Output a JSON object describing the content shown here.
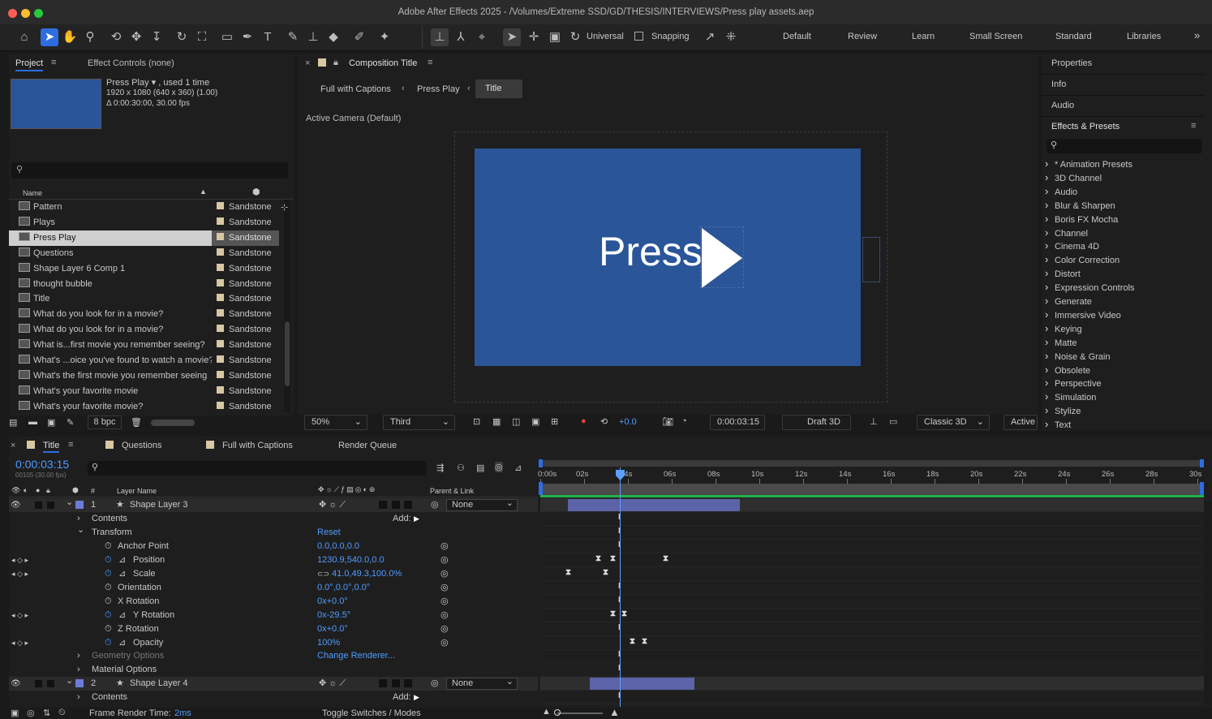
{
  "window": {
    "title": "Adobe After Effects 2025 - /Volumes/Extreme SSD/GD/THESIS/INTERVIEWS/Press play assets.aep"
  },
  "toolbar": {
    "universal": "Universal",
    "snapping": "Snapping",
    "workspaces": [
      "Default",
      "Review",
      "Learn",
      "Small Screen",
      "Standard",
      "Libraries"
    ],
    "more": "»"
  },
  "project": {
    "tab": "Project",
    "effect_controls": "Effect Controls (none)",
    "info_name": "Press Play ▾ , used 1 time",
    "info_size": "1920 x 1080  (640 x 360) (1.00)",
    "info_duration": "Δ 0:00:30:00, 30.00 fps",
    "col_name": "Name",
    "bpc": "8 bpc",
    "items": [
      {
        "name": "Pattern",
        "label": "Sandstone"
      },
      {
        "name": "Plays",
        "label": "Sandstone"
      },
      {
        "name": "Press Play",
        "label": "Sandstone"
      },
      {
        "name": "Questions",
        "label": "Sandstone"
      },
      {
        "name": "Shape Layer 6 Comp 1",
        "label": "Sandstone"
      },
      {
        "name": "thought bubble",
        "label": "Sandstone"
      },
      {
        "name": "Title",
        "label": "Sandstone"
      },
      {
        "name": "What do you look for in a movie?",
        "label": "Sandstone"
      },
      {
        "name": "What do you look for in a movie?",
        "label": "Sandstone"
      },
      {
        "name": "What is...first movie you remember seeing?",
        "label": "Sandstone"
      },
      {
        "name": "What's ...oice you've found to watch a movie?",
        "label": "Sandstone"
      },
      {
        "name": "What's the first movie you remember seeing",
        "label": "Sandstone"
      },
      {
        "name": "What's your favorite movie",
        "label": "Sandstone"
      },
      {
        "name": "What's your favorite movie?",
        "label": "Sandstone"
      }
    ]
  },
  "composition": {
    "tab": "Composition Title",
    "crumbs": [
      "Full with Captions",
      "Press Play",
      "Title"
    ],
    "camera": "Active Camera (Default)",
    "preview_text": "Press",
    "zoom": "50%",
    "resolution": "Third",
    "exposure": "+0.0",
    "timecode": "0:00:03:15",
    "draft": "Draft 3D",
    "renderer": "Classic 3D",
    "view": "Active"
  },
  "right": {
    "items": [
      "Properties",
      "Info",
      "Audio"
    ],
    "effects_title": "Effects & Presets",
    "effects": [
      "* Animation Presets",
      "3D Channel",
      "Audio",
      "Blur & Sharpen",
      "Boris FX Mocha",
      "Channel",
      "Cinema 4D",
      "Color Correction",
      "Distort",
      "Expression Controls",
      "Generate",
      "Immersive Video",
      "Keying",
      "Matte",
      "Noise & Grain",
      "Obsolete",
      "Perspective",
      "Simulation",
      "Stylize",
      "Text"
    ]
  },
  "timeline": {
    "tabs": [
      "Title",
      "Questions",
      "Full with Captions",
      "Render Queue"
    ],
    "time": "0:00:03:15",
    "frames": "00105 (30.00 fps)",
    "col_num": "#",
    "col_layer": "Layer Name",
    "col_parent": "Parent & Link",
    "ruler": [
      "0:00s",
      "02s",
      "04s",
      "06s",
      "08s",
      "10s",
      "12s",
      "14s",
      "16s",
      "18s",
      "20s",
      "22s",
      "24s",
      "26s",
      "28s",
      "30s"
    ],
    "rows": [
      {
        "label": "1",
        "name": "Shape Layer 3",
        "value": "",
        "parent": "None"
      },
      {
        "label": "Contents",
        "value": "Add:"
      },
      {
        "label": "Transform",
        "value": "Reset"
      },
      {
        "label": "Anchor Point",
        "value": "0.0,0.0,0.0"
      },
      {
        "label": "Position",
        "value": "1230.9,540.0,0.0"
      },
      {
        "label": "Scale",
        "value": "41.0,49.3,100.0%"
      },
      {
        "label": "Orientation",
        "value": "0.0°,0.0°,0.0°"
      },
      {
        "label": "X Rotation",
        "value": "0x+0.0°"
      },
      {
        "label": "Y Rotation",
        "value": "0x-29.5°"
      },
      {
        "label": "Z Rotation",
        "value": "0x+0.0°"
      },
      {
        "label": "Opacity",
        "value": "100%"
      },
      {
        "label": "Geometry Options",
        "value": "Change Renderer..."
      },
      {
        "label": "Material Options",
        "value": ""
      },
      {
        "label": "2",
        "name": "Shape Layer 4",
        "value": "",
        "parent": "None"
      },
      {
        "label": "Contents",
        "value": "Add:"
      }
    ],
    "frame_render_label": "Frame Render Time:",
    "frame_render_value": "2ms",
    "toggle": "Toggle Switches / Modes"
  },
  "colors": {
    "accent": "#2d6de0",
    "comp_bg": "#2a5598",
    "layer_bar": "#5c63a8"
  }
}
